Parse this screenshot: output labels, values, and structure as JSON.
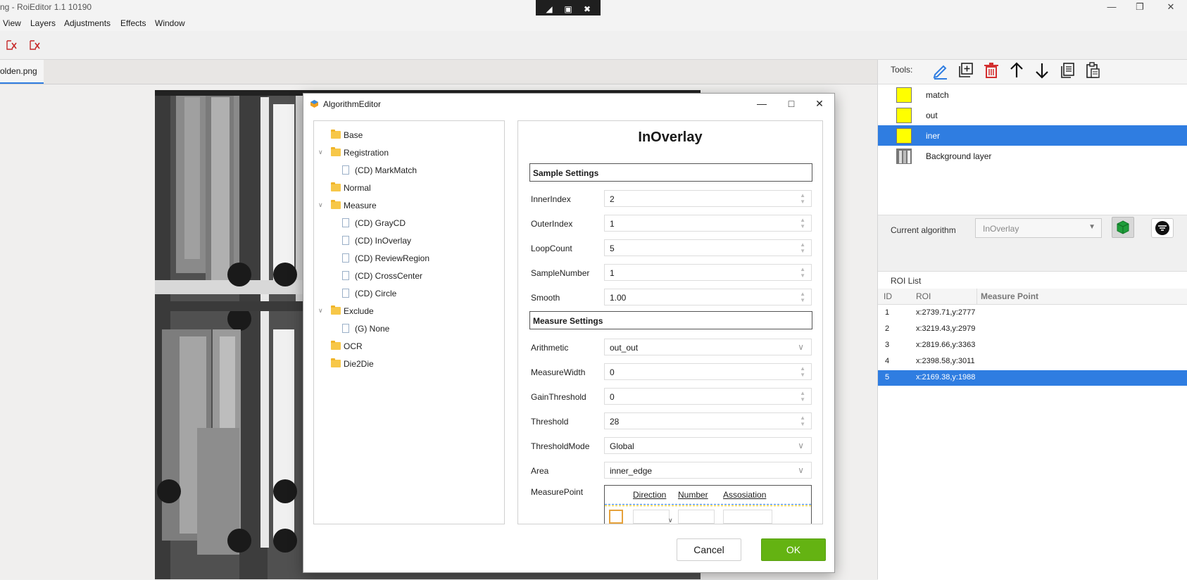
{
  "window": {
    "title": "ng - RoiEditor 1.1 10190"
  },
  "menu": [
    "View",
    "Layers",
    "Adjustments",
    "Effects",
    "Window"
  ],
  "document": {
    "tab_label": "olden.png"
  },
  "right_panel": {
    "tools_label": "Tools:",
    "layers": [
      {
        "name": "match",
        "selected": false
      },
      {
        "name": "out",
        "selected": false
      },
      {
        "name": "iner",
        "selected": true
      },
      {
        "name": "Background layer",
        "selected": false
      }
    ],
    "current_algorithm_label": "Current algorithm",
    "current_algorithm_value": "InOverlay",
    "roi_list": {
      "title": "ROI List",
      "columns": [
        "ID",
        "ROI",
        "Measure Point"
      ],
      "rows": [
        {
          "id": "1",
          "roi": "x:2739.71,y:2777"
        },
        {
          "id": "2",
          "roi": "x:3219.43,y:2979"
        },
        {
          "id": "3",
          "roi": "x:2819.66,y:3363"
        },
        {
          "id": "4",
          "roi": "x:2398.58,y:3011"
        },
        {
          "id": "5",
          "roi": "x:2169.38,y:1988"
        }
      ],
      "selected_id": "5"
    }
  },
  "dialog": {
    "title": "AlgorithmEditor",
    "tree": [
      {
        "label": "Base",
        "kind": "folder",
        "level": 0
      },
      {
        "label": "Registration",
        "kind": "folder",
        "level": 0,
        "expanded": true
      },
      {
        "label": "(CD) MarkMatch",
        "kind": "item",
        "level": 1
      },
      {
        "label": "Normal",
        "kind": "folder",
        "level": 0
      },
      {
        "label": "Measure",
        "kind": "folder",
        "level": 0,
        "expanded": true
      },
      {
        "label": "(CD) GrayCD",
        "kind": "item",
        "level": 1
      },
      {
        "label": "(CD) InOverlay",
        "kind": "item",
        "level": 1
      },
      {
        "label": "(CD) ReviewRegion",
        "kind": "item",
        "level": 1
      },
      {
        "label": "(CD) CrossCenter",
        "kind": "item",
        "level": 1
      },
      {
        "label": "(CD) Circle",
        "kind": "item",
        "level": 1
      },
      {
        "label": "Exclude",
        "kind": "folder",
        "level": 0,
        "expanded": true
      },
      {
        "label": "(G) None",
        "kind": "item",
        "level": 1
      },
      {
        "label": "OCR",
        "kind": "folder",
        "level": 0
      },
      {
        "label": "Die2Die",
        "kind": "folder",
        "level": 0
      }
    ],
    "algorithm_name": "InOverlay",
    "sample_settings": {
      "title": "Sample Settings",
      "fields": [
        {
          "label": "InnerIndex",
          "value": "2",
          "type": "spin"
        },
        {
          "label": "OuterIndex",
          "value": "1",
          "type": "spin"
        },
        {
          "label": "LoopCount",
          "value": "5",
          "type": "spin"
        },
        {
          "label": "SampleNumber",
          "value": "1",
          "type": "spin"
        },
        {
          "label": "Smooth",
          "value": "1.00",
          "type": "spin"
        }
      ]
    },
    "measure_settings": {
      "title": "Measure Settings",
      "fields": [
        {
          "label": "Arithmetic",
          "value": "out_out",
          "type": "combo"
        },
        {
          "label": "MeasureWidth",
          "value": "0",
          "type": "spin"
        },
        {
          "label": "GainThreshold",
          "value": "0",
          "type": "spin"
        },
        {
          "label": "Threshold",
          "value": "28",
          "type": "spin"
        },
        {
          "label": "ThresholdMode",
          "value": "Global",
          "type": "combo"
        },
        {
          "label": "Area",
          "value": "inner_edge",
          "type": "combo"
        }
      ]
    },
    "measure_point": {
      "label": "MeasurePoint",
      "columns": [
        "Direction",
        "Number",
        "Assosiation"
      ]
    },
    "cancel_label": "Cancel",
    "ok_label": "OK"
  },
  "colors": {
    "accent": "#2f7de1",
    "ok_green": "#64b312",
    "layer_swatch": "#ffff00",
    "delete_red": "#d32f2f"
  }
}
